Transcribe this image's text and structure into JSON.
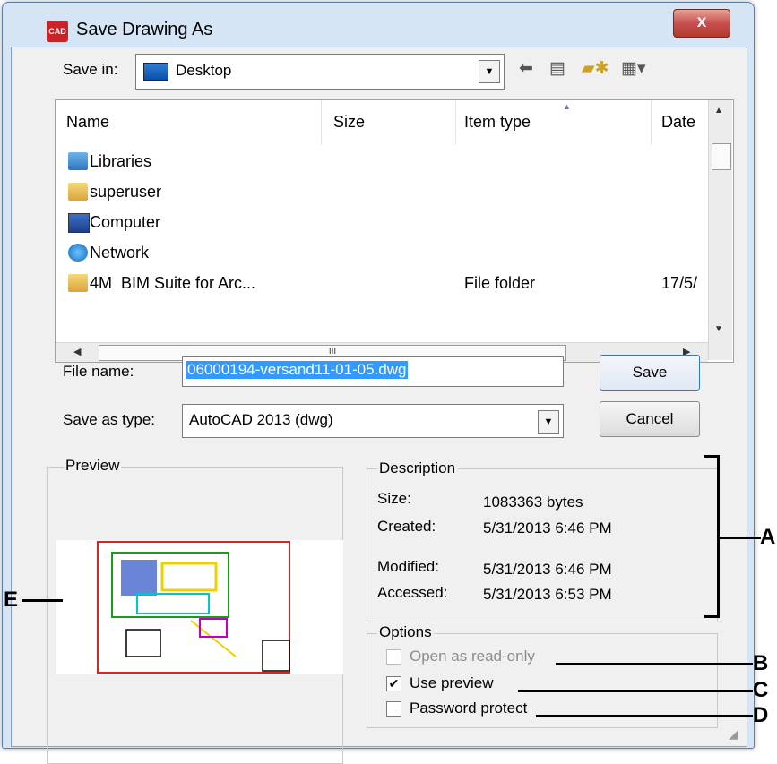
{
  "window": {
    "title": "Save Drawing As",
    "close_label": "x"
  },
  "save_in": {
    "label": "Save in:",
    "value": "Desktop",
    "toolbar_icons": [
      "back-arrow-icon",
      "up-folder-icon",
      "new-folder-icon",
      "views-menu-icon"
    ]
  },
  "file_list": {
    "columns": [
      "Name",
      "Size",
      "Item type",
      "Date"
    ],
    "rows": [
      {
        "name": "Libraries",
        "icon": "libraries-icon",
        "type": "",
        "date": ""
      },
      {
        "name": "superuser",
        "icon": "user-folder-icon",
        "type": "",
        "date": ""
      },
      {
        "name": "Computer",
        "icon": "computer-icon",
        "type": "",
        "date": ""
      },
      {
        "name": "Network",
        "icon": "network-icon",
        "type": "",
        "date": ""
      },
      {
        "name": "4M  BIM Suite for Arc...",
        "icon": "folder-icon",
        "type": "File folder",
        "date": "17/5/"
      }
    ],
    "hscroll_grip": "III"
  },
  "file_name": {
    "label": "File name:",
    "value": "06000194-versand11-01-05.dwg"
  },
  "save_as_type": {
    "label": "Save as type:",
    "value": "AutoCAD 2013 (dwg)"
  },
  "buttons": {
    "save": "Save",
    "cancel": "Cancel"
  },
  "preview": {
    "legend": "Preview"
  },
  "description": {
    "legend": "Description",
    "size_key": "Size:",
    "size_val": "1083363 bytes",
    "created_key": "Created:",
    "created_val": "5/31/2013 6:46 PM",
    "modified_key": "Modified:",
    "modified_val": "5/31/2013 6:46 PM",
    "accessed_key": "Accessed:",
    "accessed_val": "5/31/2013 6:53 PM"
  },
  "options": {
    "legend": "Options",
    "read_only": {
      "label": "Open as read-only",
      "checked": false,
      "enabled": false
    },
    "use_preview": {
      "label": "Use preview",
      "checked": true,
      "enabled": true
    },
    "password": {
      "label": "Password protect",
      "checked": false,
      "enabled": true
    }
  },
  "callouts": {
    "a": "A",
    "b": "B",
    "c": "C",
    "d": "D",
    "e": "E"
  }
}
